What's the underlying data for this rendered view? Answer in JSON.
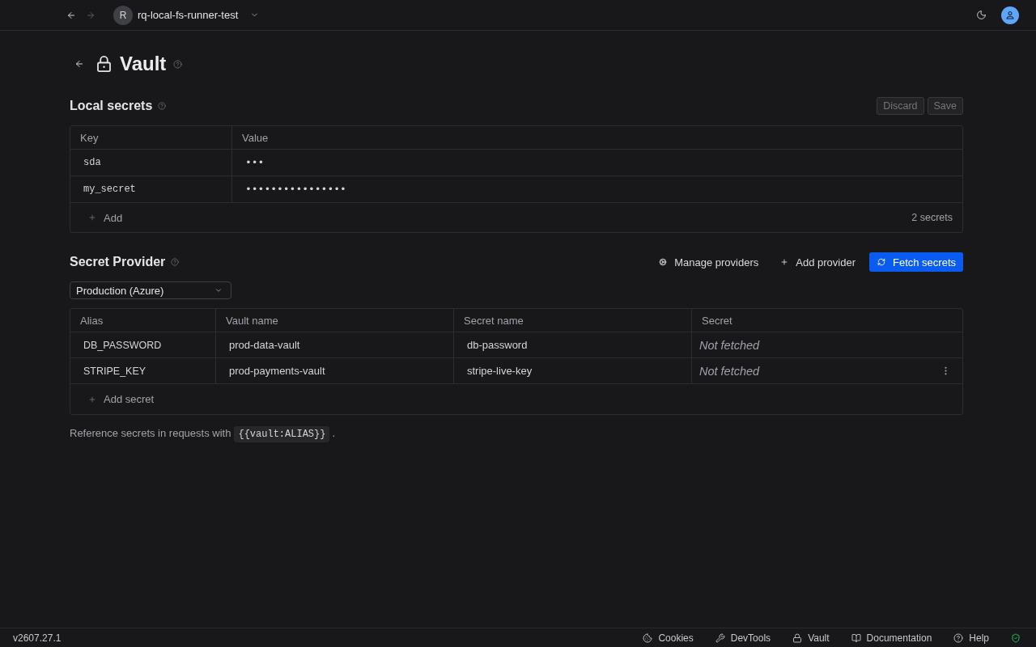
{
  "navigation": [
    {
      "kind": "back",
      "disabled": false
    },
    {
      "kind": "forward",
      "disabled": true
    }
  ],
  "workspace": {
    "initial": "R",
    "name": "rq-local-fs-runner-test"
  },
  "page": {
    "title": "Vault"
  },
  "local_secrets": {
    "title": "Local secrets",
    "actions": [
      {
        "label": "Discard",
        "disabled": true
      },
      {
        "label": "Save",
        "disabled": true
      }
    ],
    "columns": [
      "Key",
      "Value"
    ],
    "rows": [
      {
        "key": "sda",
        "value": "•••"
      },
      {
        "key": "my_secret",
        "value": "••••••••••••••••"
      }
    ],
    "add_label": "Add",
    "count": "2 secrets"
  },
  "secret_provider": {
    "title": "Secret Provider",
    "actions": [
      {
        "kind": "manage",
        "label": "Manage providers"
      },
      {
        "kind": "add",
        "label": "Add provider"
      },
      {
        "kind": "fetch",
        "label": "Fetch secrets"
      }
    ],
    "provider": "Production (Azure)",
    "columns": [
      "Alias",
      "Vault name",
      "Secret name",
      "Secret"
    ],
    "rows": [
      {
        "alias": "DB_PASSWORD",
        "vault_name": "prod-data-vault",
        "secret_name": "db-password",
        "secret": "Not fetched",
        "hovered": false
      },
      {
        "alias": "STRIPE_KEY",
        "vault_name": "prod-payments-vault",
        "secret_name": "stripe-live-key",
        "secret": "Not fetched",
        "hovered": true
      }
    ],
    "add_label": "Add secret"
  },
  "hint": {
    "text": "Reference secrets in requests with",
    "code": "{{vault:ALIAS}}",
    "after": "."
  },
  "status_bar": {
    "version": "v2607.27.1",
    "items": [
      {
        "kind": "cookies",
        "label": "Cookies"
      },
      {
        "kind": "devtools",
        "label": "DevTools"
      },
      {
        "kind": "vault",
        "label": "Vault"
      },
      {
        "kind": "documentation",
        "label": "Documentation"
      },
      {
        "kind": "help",
        "label": "Help"
      }
    ]
  }
}
